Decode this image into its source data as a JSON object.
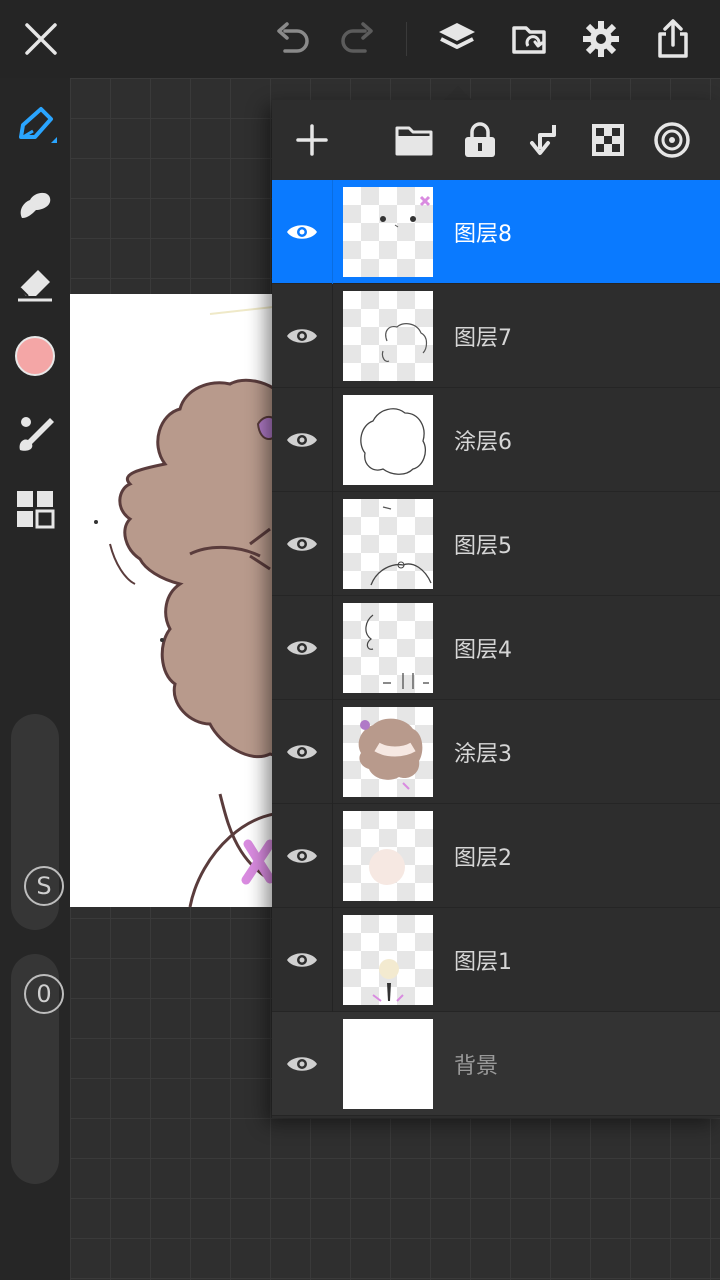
{
  "toolbar": {
    "close": "close-icon",
    "undo": "undo-icon",
    "redo": "redo-icon",
    "layers": "layers-icon",
    "gallery": "gallery-icon",
    "settings": "gear-icon",
    "share": "share-icon"
  },
  "tools": {
    "brush": "pen-icon",
    "smudge": "smudge-icon",
    "eraser": "eraser-icon",
    "color": "#f4a6a6",
    "stroke_settings": "brush-settings-icon",
    "menu": "grid-icon"
  },
  "sliders": {
    "size_knob": "S",
    "opacity_knob": "0"
  },
  "layer_panel": {
    "actions": [
      "add-icon",
      "folder-icon",
      "lock-icon",
      "merge-down-icon",
      "transparency-icon",
      "blend-icon"
    ],
    "layers": [
      {
        "name": "图层8",
        "selected": true
      },
      {
        "name": "图层7",
        "selected": false
      },
      {
        "name": "涂层6",
        "selected": false
      },
      {
        "name": "图层5",
        "selected": false
      },
      {
        "name": "图层4",
        "selected": false
      },
      {
        "name": "涂层3",
        "selected": false
      },
      {
        "name": "图层2",
        "selected": false
      },
      {
        "name": "图层1",
        "selected": false
      },
      {
        "name": "背景",
        "selected": false
      }
    ]
  },
  "colors": {
    "accent": "#0a7aff",
    "panel": "#2d2d2d",
    "hair": "#b89a8c",
    "ribbon": "#d98be0"
  }
}
